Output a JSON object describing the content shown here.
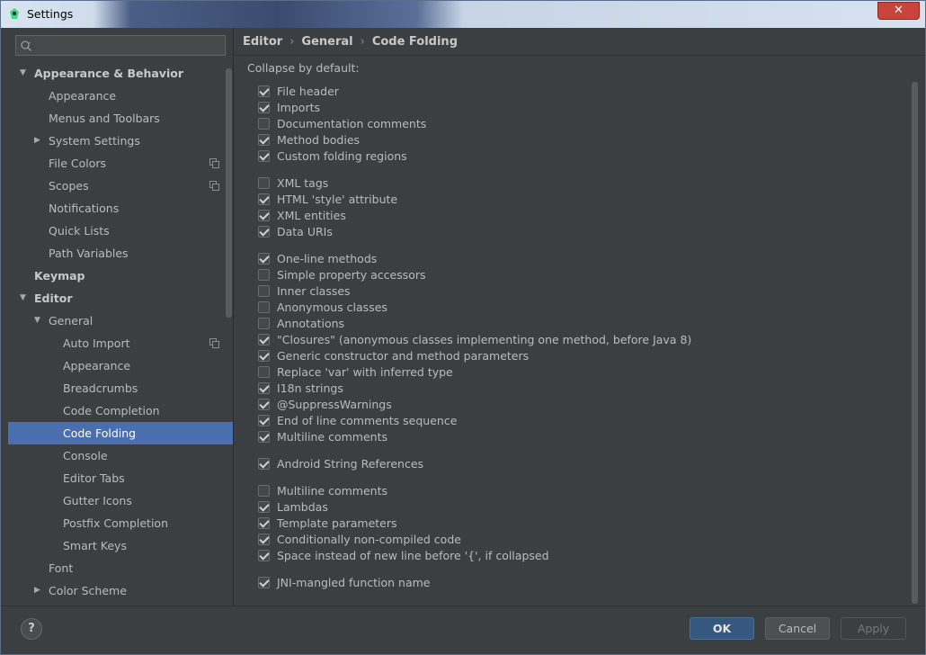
{
  "window": {
    "title": "Settings",
    "close_label": "✕"
  },
  "search": {
    "placeholder": "",
    "value": ""
  },
  "tree": [
    {
      "label": "Appearance & Behavior",
      "level": 0,
      "arrow": "expanded",
      "bold": true
    },
    {
      "label": "Appearance",
      "level": 1
    },
    {
      "label": "Menus and Toolbars",
      "level": 1
    },
    {
      "label": "System Settings",
      "level": 1,
      "arrow": "collapsed"
    },
    {
      "label": "File Colors",
      "level": 1,
      "copy": true
    },
    {
      "label": "Scopes",
      "level": 1,
      "copy": true
    },
    {
      "label": "Notifications",
      "level": 1
    },
    {
      "label": "Quick Lists",
      "level": 1
    },
    {
      "label": "Path Variables",
      "level": 1
    },
    {
      "label": "Keymap",
      "level": 0,
      "bold": true
    },
    {
      "label": "Editor",
      "level": 0,
      "arrow": "expanded",
      "bold": true
    },
    {
      "label": "General",
      "level": 1,
      "arrow": "expanded"
    },
    {
      "label": "Auto Import",
      "level": 2,
      "copy": true
    },
    {
      "label": "Appearance",
      "level": 2
    },
    {
      "label": "Breadcrumbs",
      "level": 2
    },
    {
      "label": "Code Completion",
      "level": 2
    },
    {
      "label": "Code Folding",
      "level": 2,
      "selected": true
    },
    {
      "label": "Console",
      "level": 2
    },
    {
      "label": "Editor Tabs",
      "level": 2
    },
    {
      "label": "Gutter Icons",
      "level": 2
    },
    {
      "label": "Postfix Completion",
      "level": 2
    },
    {
      "label": "Smart Keys",
      "level": 2
    },
    {
      "label": "Font",
      "level": 1
    },
    {
      "label": "Color Scheme",
      "level": 1,
      "arrow": "collapsed"
    }
  ],
  "breadcrumb": [
    "Editor",
    "General",
    "Code Folding"
  ],
  "section_label": "Collapse by default:",
  "option_groups": [
    [
      {
        "label": "File header",
        "checked": true
      },
      {
        "label": "Imports",
        "checked": true
      },
      {
        "label": "Documentation comments",
        "checked": false
      },
      {
        "label": "Method bodies",
        "checked": true
      },
      {
        "label": "Custom folding regions",
        "checked": true
      }
    ],
    [
      {
        "label": "XML tags",
        "checked": false
      },
      {
        "label": "HTML 'style' attribute",
        "checked": true
      },
      {
        "label": "XML entities",
        "checked": true
      },
      {
        "label": "Data URIs",
        "checked": true
      }
    ],
    [
      {
        "label": "One-line methods",
        "checked": true
      },
      {
        "label": "Simple property accessors",
        "checked": false
      },
      {
        "label": "Inner classes",
        "checked": false
      },
      {
        "label": "Anonymous classes",
        "checked": false
      },
      {
        "label": "Annotations",
        "checked": false
      },
      {
        "label": "\"Closures\" (anonymous classes implementing one method, before Java 8)",
        "checked": true
      },
      {
        "label": "Generic constructor and method parameters",
        "checked": true
      },
      {
        "label": "Replace 'var' with inferred type",
        "checked": false
      },
      {
        "label": "I18n strings",
        "checked": true
      },
      {
        "label": "@SuppressWarnings",
        "checked": true
      },
      {
        "label": "End of line comments sequence",
        "checked": true
      },
      {
        "label": "Multiline comments",
        "checked": true
      }
    ],
    [
      {
        "label": "Android String References",
        "checked": true
      }
    ],
    [
      {
        "label": "Multiline comments",
        "checked": false
      },
      {
        "label": "Lambdas",
        "checked": true
      },
      {
        "label": "Template parameters",
        "checked": true
      },
      {
        "label": "Conditionally non-compiled code",
        "checked": true
      },
      {
        "label": "Space instead of new line before '{', if collapsed",
        "checked": true
      }
    ],
    [
      {
        "label": "JNI-mangled function name",
        "checked": true
      }
    ]
  ],
  "buttons": {
    "help": "?",
    "ok": "OK",
    "cancel": "Cancel",
    "apply": "Apply"
  }
}
